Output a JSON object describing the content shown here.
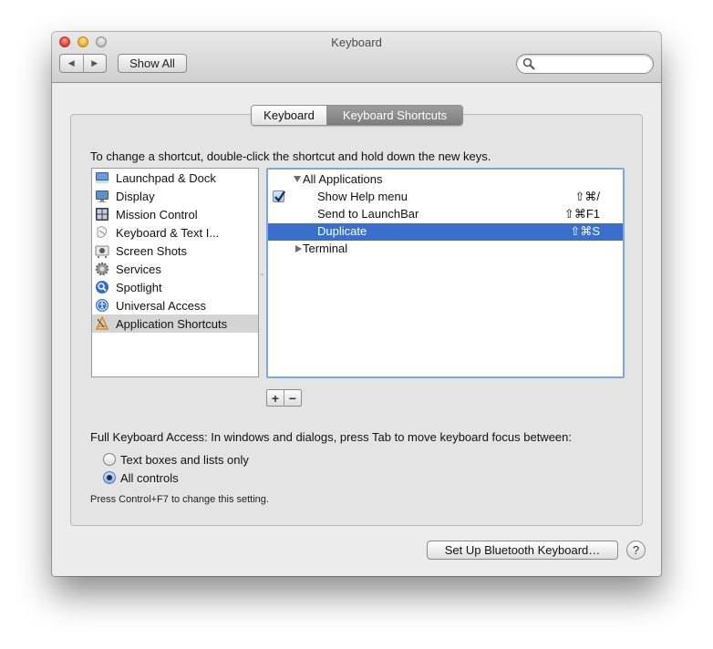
{
  "window": {
    "title": "Keyboard",
    "search_placeholder": "",
    "nav": {
      "back_icon": "chevron-left-icon",
      "forward_icon": "chevron-right-icon"
    },
    "show_all_label": "Show All"
  },
  "tabs": [
    {
      "label": "Keyboard",
      "selected": false
    },
    {
      "label": "Keyboard Shortcuts",
      "selected": true
    }
  ],
  "instructions": "To change a shortcut, double-click the shortcut and hold down the new keys.",
  "categories": [
    {
      "label": "Launchpad & Dock",
      "icon": "launchpad-dock-icon",
      "selected": false
    },
    {
      "label": "Display",
      "icon": "display-icon",
      "selected": false
    },
    {
      "label": "Mission Control",
      "icon": "mission-control-icon",
      "selected": false
    },
    {
      "label": "Keyboard & Text I...",
      "icon": "keyboard-text-input-icon",
      "selected": false
    },
    {
      "label": "Screen Shots",
      "icon": "screen-shots-icon",
      "selected": false
    },
    {
      "label": "Services",
      "icon": "services-gear-icon",
      "selected": false
    },
    {
      "label": "Spotlight",
      "icon": "spotlight-icon",
      "selected": false
    },
    {
      "label": "Universal Access",
      "icon": "universal-access-icon",
      "selected": false
    },
    {
      "label": "Application Shortcuts",
      "icon": "application-shortcuts-icon",
      "selected": true
    }
  ],
  "shortcuts": {
    "groups": [
      {
        "label": "All Applications",
        "expanded": true,
        "items": [
          {
            "label": "Show Help menu",
            "keys": "⇧⌘/",
            "checked": true,
            "selected": false
          },
          {
            "label": "Send to LaunchBar",
            "keys": "⇧⌘F1",
            "checked": false,
            "selected": false
          },
          {
            "label": "Duplicate",
            "keys": "⇧⌘S",
            "checked": false,
            "selected": true
          }
        ]
      },
      {
        "label": "Terminal",
        "expanded": false,
        "items": []
      }
    ]
  },
  "buttons": {
    "add": "+",
    "remove": "−",
    "bluetooth": "Set Up Bluetooth Keyboard…",
    "help": "?"
  },
  "full_keyboard_access": {
    "label": "Full Keyboard Access: In windows and dialogs, press Tab to move keyboard focus between:",
    "options": [
      {
        "label": "Text boxes and lists only",
        "selected": false
      },
      {
        "label": "All controls",
        "selected": true
      }
    ],
    "hint": "Press Control+F7 to change this setting."
  },
  "colors": {
    "selection_blue": "#3a6fcc",
    "focus_ring": "#7fa8d7",
    "selected_tab": "#8a8a8a",
    "category_selected": "#d4d4d4"
  }
}
